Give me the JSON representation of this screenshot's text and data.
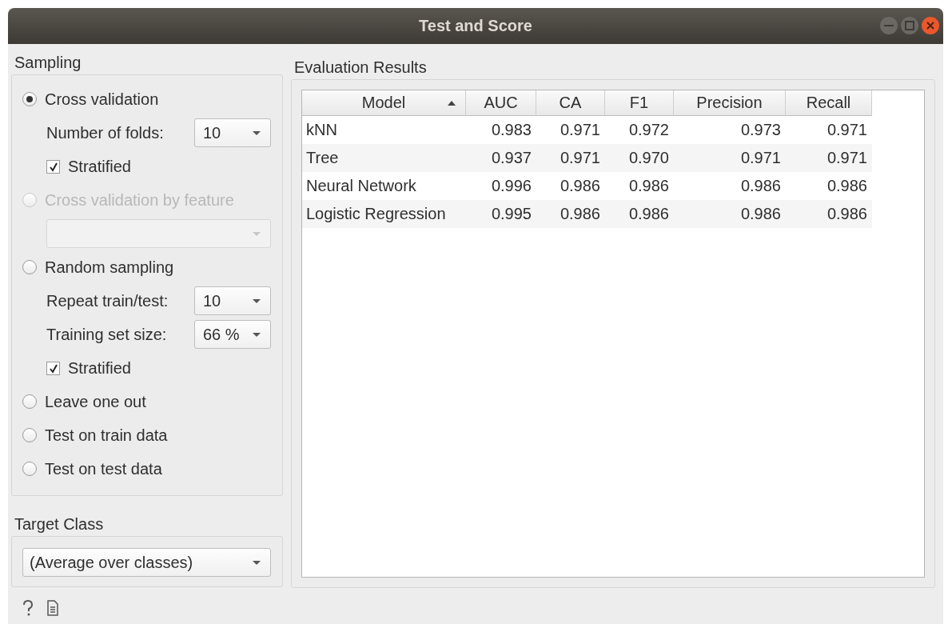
{
  "window": {
    "title": "Test and Score"
  },
  "sampling": {
    "label": "Sampling",
    "items": [
      {
        "kind": "radio",
        "label": "Cross validation",
        "selected": true,
        "disabled": false
      },
      {
        "kind": "combo",
        "label": "Number of folds:",
        "value": "10",
        "disabled": false
      },
      {
        "kind": "check",
        "label": "Stratified",
        "checked": true
      },
      {
        "kind": "radio",
        "label": "Cross validation by feature",
        "selected": false,
        "disabled": true
      },
      {
        "kind": "combo",
        "disabled": true
      },
      {
        "kind": "radio",
        "label": "Random sampling",
        "selected": false,
        "disabled": false
      },
      {
        "kind": "combo",
        "label": "Repeat train/test:",
        "value": "10",
        "disabled": false
      },
      {
        "kind": "combo",
        "label": "Training set size:",
        "value": "66 %",
        "disabled": false
      },
      {
        "kind": "check",
        "label": "Stratified",
        "checked": true
      },
      {
        "kind": "radio",
        "label": "Leave one out",
        "selected": false,
        "disabled": false
      },
      {
        "kind": "radio",
        "label": "Test on train data",
        "selected": false,
        "disabled": false
      },
      {
        "kind": "radio",
        "label": "Test on test data",
        "selected": false,
        "disabled": false
      }
    ]
  },
  "target_class": {
    "label": "Target Class",
    "value": "(Average over classes)"
  },
  "results": {
    "label": "Evaluation Results",
    "columns": [
      {
        "label": "Model",
        "sorted": true
      },
      {
        "label": "AUC",
        "sorted": false
      },
      {
        "label": "CA",
        "sorted": false
      },
      {
        "label": "F1",
        "sorted": false
      },
      {
        "label": "Precision",
        "sorted": false
      },
      {
        "label": "Recall",
        "sorted": false
      }
    ],
    "rows": [
      [
        "kNN",
        "0.983",
        "0.971",
        "0.972",
        "0.973",
        "0.971"
      ],
      [
        "Tree",
        "0.937",
        "0.971",
        "0.970",
        "0.971",
        "0.971"
      ],
      [
        "Neural Network",
        "0.996",
        "0.986",
        "0.986",
        "0.986",
        "0.986"
      ],
      [
        "Logistic Regression",
        "0.995",
        "0.986",
        "0.986",
        "0.986",
        "0.986"
      ]
    ]
  }
}
